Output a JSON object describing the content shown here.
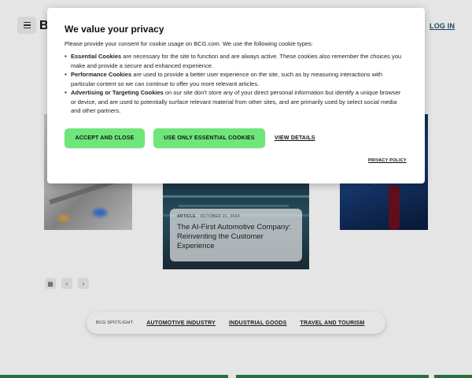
{
  "header": {
    "logo_text": "BC",
    "login_label": "LOG IN"
  },
  "carousel": {
    "center_card": {
      "type": "ARTICLE",
      "date": "OCTOBER 21, 2024",
      "title": "The AI-First Automotive Company: Reinventing the Customer Experience"
    },
    "controls": {
      "grid_icon": "grid-icon",
      "prev_icon": "chevron-left-icon",
      "next_icon": "chevron-right-icon"
    }
  },
  "tags_bar": {
    "spotlight_label": "BCG SPOTLIGHT",
    "tags": [
      "AUTOMOTIVE INDUSTRY",
      "INDUSTRIAL GOODS",
      "TRAVEL AND TOURISM"
    ]
  },
  "consent": {
    "title": "We value your privacy",
    "intro": "Please provide your consent for cookie usage on BCG.com. We use the following cookie types:",
    "items": [
      {
        "name": "Essential Cookies",
        "text": " are necessary for the site to function and are always active. These cookies also remember the choices you make and provide a secure and enhanced experience."
      },
      {
        "name": "Performance Cookies",
        "text": " are used to provide a better user experience on the site, such as by measuring interactions with particular content so we can continue to offer you more relevant articles."
      },
      {
        "name": "Advertising or Targeting Cookies",
        "text": " on our site don't store any of your direct personal information but identify a unique browser or device, and are used to potentially surface relevant material from other sites, and are primarily used by select social media and other partners."
      }
    ],
    "accept_label": "ACCEPT AND CLOSE",
    "essential_label": "USE ONLY ESSENTIAL COOKIES",
    "details_label": "VIEW DETAILS",
    "privacy_label": "PRIVACY POLICY"
  },
  "colors": {
    "button_green": "#6fe67a",
    "login_blue": "#1a4c6e",
    "band_green": "#2f7a45"
  }
}
